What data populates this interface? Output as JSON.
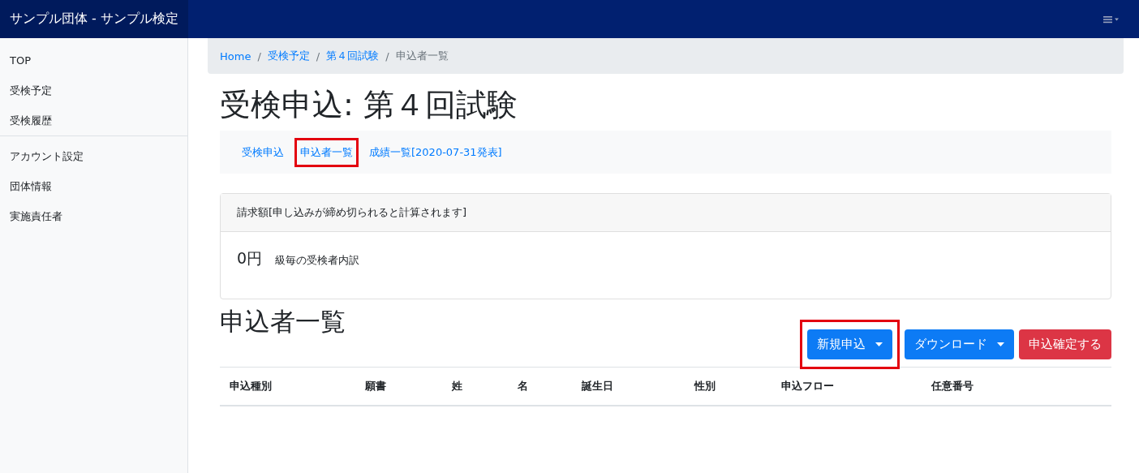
{
  "navbar": {
    "brand": "サンプル団体 - サンプル検定"
  },
  "sidebar": {
    "groups": [
      {
        "items": [
          {
            "label": "TOP"
          },
          {
            "label": "受検予定"
          },
          {
            "label": "受検履歴"
          }
        ]
      },
      {
        "items": [
          {
            "label": "アカウント設定"
          },
          {
            "label": "団体情報"
          },
          {
            "label": "実施責任者"
          }
        ]
      }
    ]
  },
  "breadcrumb": [
    {
      "label": "Home",
      "kind": "link"
    },
    {
      "separator": "/",
      "label": "受検予定",
      "kind": "link"
    },
    {
      "separator": "/",
      "label": "第４回試験",
      "kind": "link"
    },
    {
      "separator": "/",
      "label": "申込者一覧",
      "kind": "current"
    }
  ],
  "title": "受検申込: 第４回試験",
  "subnav": [
    {
      "label": "受検申込",
      "highlighted": false
    },
    {
      "label": "申込者一覧",
      "highlighted": true
    },
    {
      "label": "成績一覧[2020-07-31発表]",
      "highlighted": false
    }
  ],
  "billing": {
    "header": "請求額[申し込みが締め切られると計算されます]",
    "amount": "0円",
    "breakdown": "級毎の受検者内訳"
  },
  "list_title": "申込者一覧",
  "buttons": [
    {
      "label": "新規申込",
      "kind": "primary",
      "dropdown": true,
      "highlighted": true
    },
    {
      "label": "ダウンロード",
      "kind": "primary",
      "dropdown": true,
      "highlighted": false
    },
    {
      "label": "申込確定する",
      "kind": "danger",
      "dropdown": false,
      "highlighted": false
    }
  ],
  "table": {
    "columns": [
      "申込種別",
      "願書",
      "姓",
      "名",
      "誕生日",
      "性別",
      "申込フロー",
      "任意番号"
    ]
  }
}
